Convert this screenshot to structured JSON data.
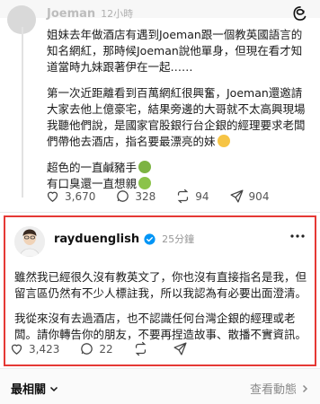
{
  "post": {
    "username": "Joeman",
    "time": "12小時",
    "paragraphs": [
      "姐妹去年做酒店有遇到Joeman跟一個教英國語言的知名網紅，那時候Joeman說他單身，但現在看才知道當時九妹跟著伊在一起……",
      "第一次近距離看到百萬網紅很興奮，Joeman還邀請大家去他上億豪宅，結果旁邊的大哥就不太高興現場我聽他們說，是國家官股銀行台企銀的經理要求老闆們帶他去酒店，指名要最漂亮的妹"
    ],
    "line3": "超色的一直鹹豬手",
    "line4": "有口臭還一直想親",
    "stats": {
      "likes": "3,670",
      "comments": "328",
      "reposts": "94",
      "shares": "904"
    }
  },
  "reply": {
    "username": "rayduenglish",
    "time": "25分鐘",
    "paragraphs": [
      "雖然我已經很久沒有教英文了，你也沒有直接指名是我，但留言區仍然有不少人標註我，所以我認為有必要出面澄清。",
      "我從來沒有去過酒店，也不認識任何台灣企銀的經理或老闆。請你轉告你的朋友，不要再捏造故事、散播不實資訊。"
    ],
    "stats": {
      "likes": "3,423",
      "comments": "22",
      "reposts": "",
      "shares": ""
    }
  },
  "bottom": {
    "sort_label": "最相關",
    "activity_label": "查看動態"
  },
  "colors": {
    "highlight_border": "#e53935",
    "verified": "#0095f6"
  }
}
